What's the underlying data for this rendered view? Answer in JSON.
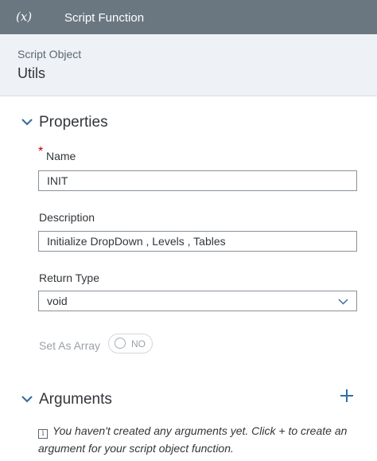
{
  "header": {
    "icon": "function-icon",
    "icon_glyph": "(x)",
    "title": "Script Function"
  },
  "script_object": {
    "label": "Script Object",
    "value": "Utils"
  },
  "properties": {
    "section_title": "Properties",
    "name": {
      "label": "Name",
      "required_marker": "*",
      "value": "INIT"
    },
    "description": {
      "label": "Description",
      "value": "Initialize DropDown , Levels , Tables"
    },
    "return_type": {
      "label": "Return Type",
      "value": "void"
    },
    "set_as_array": {
      "label": "Set As Array",
      "state": "NO"
    }
  },
  "arguments": {
    "section_title": "Arguments",
    "add_icon": "plus-icon",
    "info_icon_glyph": "i",
    "info_text": "You haven't created any arguments yet. Click + to create an argument for your script object function."
  }
}
